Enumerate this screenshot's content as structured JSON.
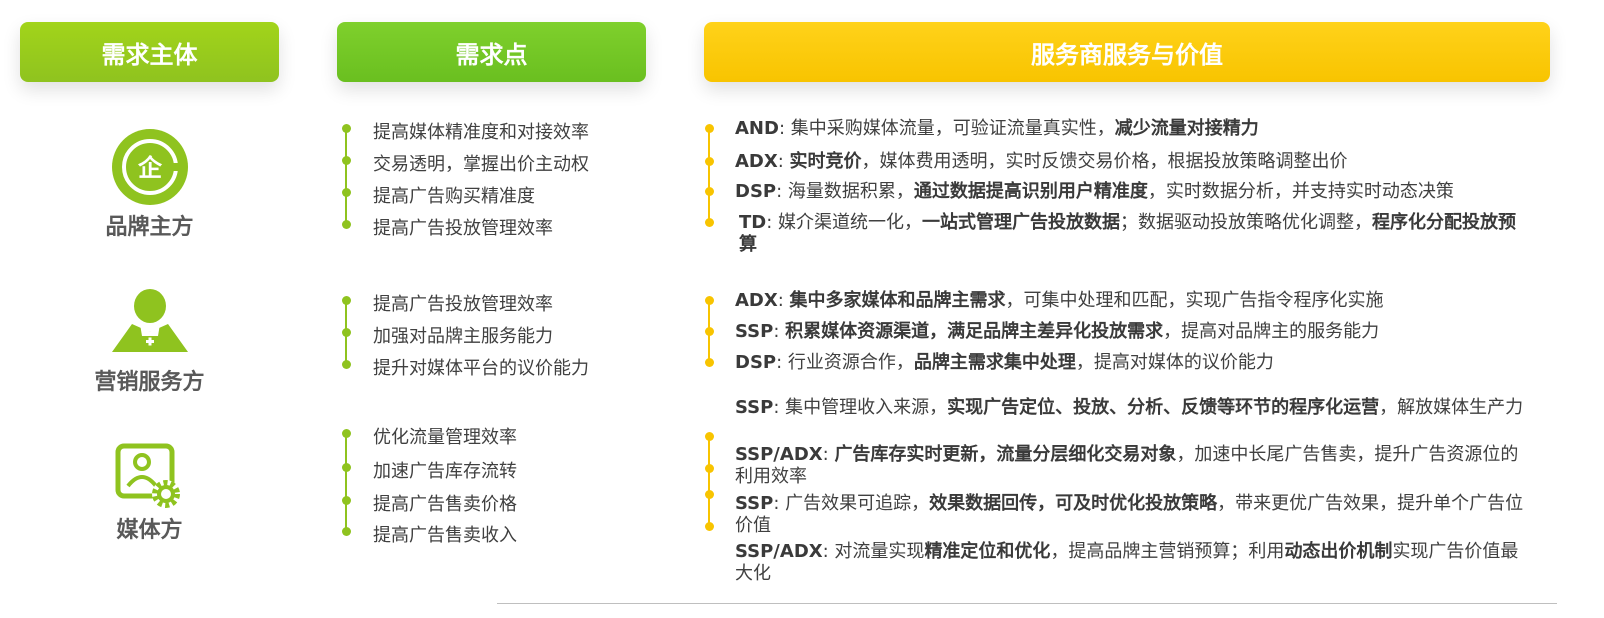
{
  "headers": {
    "col1": "需求主体",
    "col2": "需求点",
    "col3": "服务商服务与价值"
  },
  "colors": {
    "green_light": "#8fc31f",
    "green": "#6abf20",
    "yellow": "#f8c400",
    "text": "#404040"
  },
  "entities": [
    {
      "label": "品牌主方",
      "icon": "enterprise-icon",
      "needs": [
        "提高媒体精准度和对接效率",
        "交易透明，掌握出价主动权",
        "提高广告购买精准度",
        "提高广告投放管理效率"
      ]
    },
    {
      "label": "营销服务方",
      "icon": "service-person-icon",
      "needs": [
        "提高广告投放管理效率",
        "加强对品牌主服务能力",
        "提升对媒体平台的议价能力"
      ]
    },
    {
      "label": "媒体方",
      "icon": "user-settings-icon",
      "needs": [
        "优化流量管理效率",
        "加速广告库存流转",
        "提高广告售卖价格",
        "提高广告售卖收入"
      ]
    }
  ],
  "services": [
    [
      {
        "key": "AND",
        "p1": ": 集中采购媒体流量，可验证流量真实性，",
        "b1": "减少流量对接精力",
        "p2": "",
        "b2": "",
        "p3": ""
      },
      {
        "key": "ADX",
        "p1": ": ",
        "b1": "实时竞价",
        "p2": "，媒体费用透明，实时反馈交易价格，根据投放策略调整出价",
        "b2": "",
        "p3": ""
      },
      {
        "key": "DSP",
        "p1": ": 海量数据积累，",
        "b1": "通过数据提高识别用户精准度",
        "p2": "，实时数据分析，并支持实时动态决策",
        "b2": "",
        "p3": ""
      },
      {
        "key": "TD",
        "p1": ": 媒介渠道统一化，",
        "b1": "一站式管理广告投放数据",
        "p2": "；数据驱动投放策略优化调整，",
        "b2": "程序化分配投放预算",
        "p3": ""
      }
    ],
    [
      {
        "key": "ADX",
        "p1": ": ",
        "b1": "集中多家媒体和品牌主需求",
        "p2": "，可集中处理和匹配，实现广告指令程序化实施",
        "b2": "",
        "p3": ""
      },
      {
        "key": "SSP",
        "p1": ": ",
        "b1": "积累媒体资源渠道，满足品牌主差异化投放需求",
        "p2": "，提高对品牌主的服务能力",
        "b2": "",
        "p3": ""
      },
      {
        "key": "DSP",
        "p1": ": 行业资源合作，",
        "b1": "品牌主需求集中处理",
        "p2": "，提高对媒体的议价能力",
        "b2": "",
        "p3": ""
      }
    ],
    [
      {
        "key": "SSP",
        "p1": ": 集中管理收入来源，",
        "b1": "实现广告定位、投放、分析、反馈等环节的程序化运营",
        "p2": "，解放媒体生产力",
        "b2": "",
        "p3": ""
      },
      {
        "key": "SSP/ADX",
        "p1": ": ",
        "b1": "广告库存实时更新，流量分层细化交易对象",
        "p2": "，加速中长尾广告售卖，提升广告资源位的利用效率",
        "b2": "",
        "p3": ""
      },
      {
        "key": "SSP",
        "p1": ": 广告效果可追踪，",
        "b1": "效果数据回传，可及时优化投放策略",
        "p2": "，带来更优广告效果，提升单个广告位价值",
        "b2": "",
        "p3": ""
      },
      {
        "key": "SSP/ADX",
        "p1": ": 对流量实现",
        "b1": "精准定位和优化",
        "p2": "，提高品牌主营销预算；利用",
        "b2": "动态出价机制",
        "p3": "实现广告价值最大化"
      }
    ]
  ]
}
